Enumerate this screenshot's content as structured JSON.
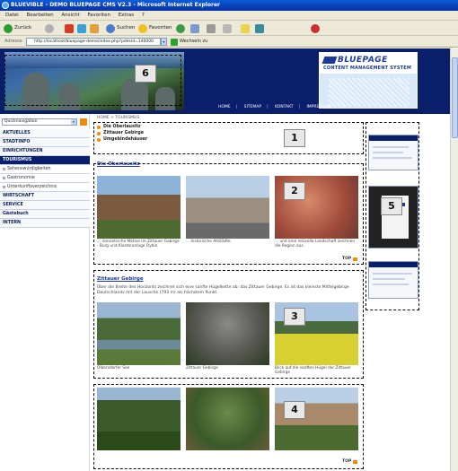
{
  "window": {
    "title": "BLUEVIBLE - DEMO BLUEPAGE CMS V2.3 - Microsoft Internet Explorer"
  },
  "menu": [
    "Datei",
    "Bearbeiten",
    "Ansicht",
    "Favoriten",
    "Extras",
    "?"
  ],
  "toolbar": {
    "back": "Zurück",
    "search": "Suchen",
    "favorites": "Favoriten"
  },
  "address": {
    "label": "Adresse",
    "url": "http://localhost/bluepage-demo/index.php?pdesid=140000",
    "go": "Wechseln zu"
  },
  "brand": {
    "title": "BLUEPAGE",
    "subtitle": "CONTENT MANAGEMENT SYSTEM"
  },
  "topnav": [
    "HOME",
    "SITEMAP",
    "KONTAKT",
    "IMPRESSUM"
  ],
  "quicknav": {
    "label": "Quicknavigation"
  },
  "sidebar": {
    "items": [
      {
        "label": "AKTUELLES",
        "type": "main"
      },
      {
        "label": "STADTINFO",
        "type": "main"
      },
      {
        "label": "EINRICHTUNGEN",
        "type": "main"
      },
      {
        "label": "TOURISMUS",
        "type": "active"
      },
      {
        "label": "Sehenswürdigkeiten",
        "type": "sub"
      },
      {
        "label": "Gastronomie",
        "type": "sub"
      },
      {
        "label": "Unterkunftsverzeichnis",
        "type": "sub"
      },
      {
        "label": "WIRTSCHAFT",
        "type": "main"
      },
      {
        "label": "SERVICE",
        "type": "main"
      },
      {
        "label": "Gästebuch",
        "type": "main"
      },
      {
        "label": "INTERN",
        "type": "main"
      }
    ]
  },
  "breadcrumb": "HOME > TOURISMUS",
  "toplinks": [
    "Die Oberlausitz",
    "Zittauer Gebirge",
    "Umgebindehäuser"
  ],
  "section1": {
    "title": "Die Oberlausitz",
    "captions": [
      "... romantische Motive im Zittauer Gebirge - Burg und Klosteranlage Oybin",
      "... historische Altstädte",
      "... und eine reizvolle Landschaft zeichnen die Region aus."
    ],
    "top": "TOP"
  },
  "section2": {
    "title": "Zittauer Gebirge",
    "text": "Über die Breite des Horizonts zeichnet sich eine sanfte Hügelkette ab: das Zittauer Gebirge. Es ist das kleinste Mittelgebirge Deutschlands mit der Lausche (793 m) als höchstem Punkt.",
    "captions": [
      "Olbersdorfer See",
      "Zittauer Gebirge",
      "Blick auf die sanften Hügel der Zittauer Gebirge"
    ]
  },
  "section3": {
    "top": "TOP"
  },
  "callouts": [
    "6",
    "1",
    "2",
    "5",
    "3",
    "4"
  ]
}
